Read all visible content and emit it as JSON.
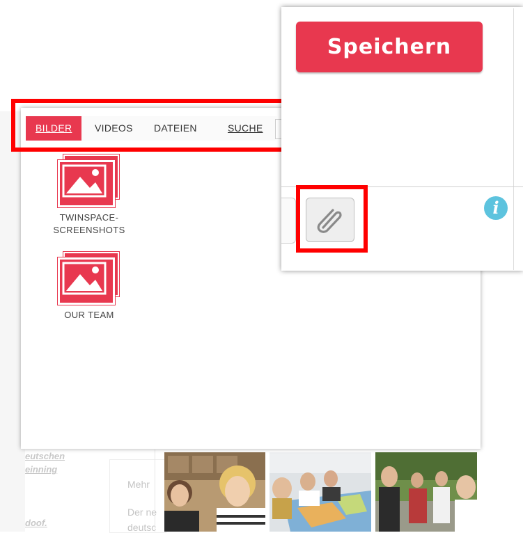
{
  "tabs": {
    "images": "BILDER",
    "videos": "VIDEOS",
    "files": "DATEIEN",
    "search": "SUCHE"
  },
  "folders": [
    {
      "label_line1": "TWINSPACE-",
      "label_line2": "SCREENSHOTS"
    },
    {
      "label_line1": "OUR TEAM",
      "label_line2": ""
    }
  ],
  "editor": {
    "save_label": "Speichern",
    "info_glyph": "i"
  },
  "background": {
    "link1": "eutschen",
    "link2": "einning",
    "link3": "doof.",
    "card_text1": "Mehr",
    "card_text2": "Der ne",
    "card_text3": "deutsc"
  },
  "colors": {
    "accent": "#e8384f",
    "highlight_frame": "#ff0000",
    "info": "#5dc3de"
  }
}
